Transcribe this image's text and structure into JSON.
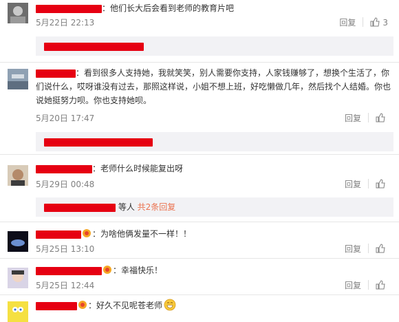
{
  "labels": {
    "reply": "回复"
  },
  "colors": {
    "username": "#eb7350",
    "redaction": "#e60012",
    "meta": "#808080",
    "reply_bg": "#f2f2f5"
  },
  "comments": [
    {
      "text": "：他们长大后会看到老师的教育片吧",
      "time": "5月22日 22:13",
      "likes": "3",
      "reply_preview": {
        "suffix": "",
        "count": ""
      }
    },
    {
      "text": "：看到很多人支持她，我就笑笑，别人需要你支持，人家钱赚够了，想换个生活了，你们说什么，哎呀谁没有过去，那照这样说，小姐不想上班，好吃懒做几年，然后找个人结婚。你也说她挺努力呗。你也支持她呗。",
      "time": "5月20日 17:47",
      "likes": "",
      "reply_preview": {
        "suffix": "",
        "count": ""
      }
    },
    {
      "text": "：老师什么时候能复出呀",
      "time": "5月29日 00:48",
      "likes": "",
      "reply_preview": {
        "suffix": "等人",
        "count": "共2条回复"
      }
    },
    {
      "text": "：为啥他俩发量不一样！！",
      "time": "5月25日 13:10",
      "likes": "",
      "reply_preview": null
    },
    {
      "text": "：幸福快乐！",
      "time": "5月25日 12:44",
      "likes": "",
      "reply_preview": null
    },
    {
      "text": "：好久不见呢苍老师",
      "time": "",
      "likes": "",
      "reply_preview": null
    }
  ]
}
